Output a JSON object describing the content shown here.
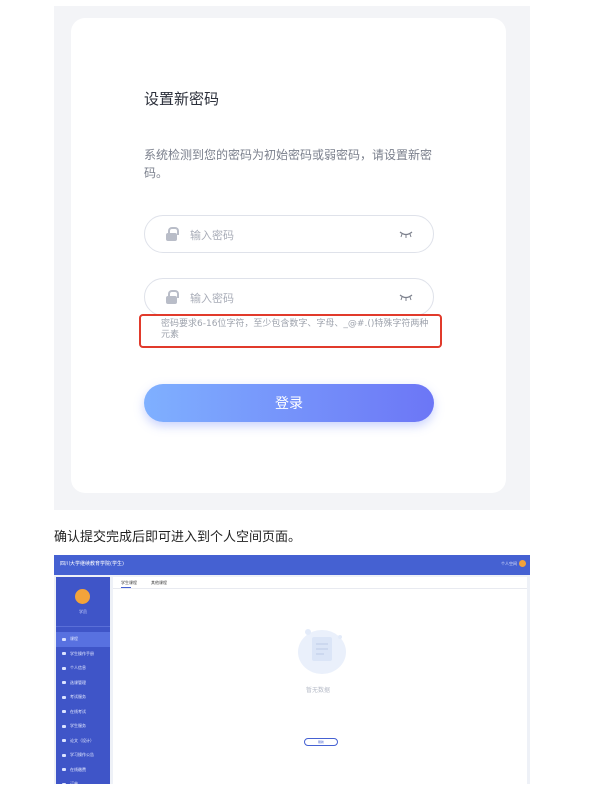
{
  "login_screen": {
    "title": "设置新密码",
    "description": "系统检测到您的密码为初始密码或弱密码，请设置新密码。",
    "password_placeholder": "输入密码",
    "confirm_placeholder": "输入密码",
    "requirement_hint": "密码要求6-16位字符，至少包含数字、字母、_@#.()特殊字符两种元素",
    "submit_label": "登录",
    "colors": {
      "button_start": "#7fb0ff",
      "button_end": "#6c76f6",
      "highlight_border": "#e13a2b"
    }
  },
  "caption": "确认提交完成后即可进入到个人空间页面。",
  "space_screen": {
    "system_name": "四川大学继续教育学院(学生)",
    "user_label": "个人空间",
    "user_name": "学员",
    "menu_items": [
      {
        "label": "课程",
        "active": true
      },
      {
        "label": "学生操作手册",
        "active": false
      },
      {
        "label": "个人信息",
        "active": false
      },
      {
        "label": "选课管理",
        "active": false
      },
      {
        "label": "考试服务",
        "active": false
      },
      {
        "label": "在线考试",
        "active": false
      },
      {
        "label": "学生服务",
        "active": false
      },
      {
        "label": "论文（设计）",
        "active": false
      },
      {
        "label": "学习操作公告",
        "active": false
      },
      {
        "label": "在线缴费",
        "active": false
      },
      {
        "label": "订单",
        "active": false
      }
    ],
    "tabs": [
      {
        "label": "学生课程"
      },
      {
        "label": "其他课程"
      }
    ],
    "empty_text": "暂无数据",
    "empty_button": "刷新",
    "colors": {
      "topbar": "#4561d2",
      "sidebar": "#3f55c8"
    }
  }
}
